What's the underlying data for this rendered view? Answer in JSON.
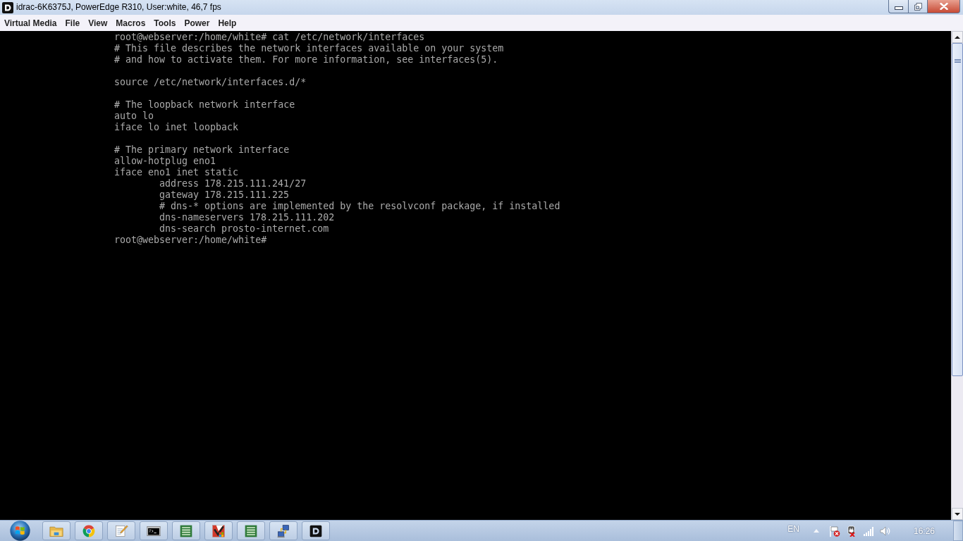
{
  "window": {
    "title": "idrac-6K6375J, PowerEdge R310, User:white, 46,7 fps"
  },
  "menu_bar": [
    "Virtual Media",
    "File",
    "View",
    "Macros",
    "Tools",
    "Power",
    "Help"
  ],
  "terminal": {
    "paragraphs": [
      [
        {
          "text": "root@webserver:/home/white# cat /etc/network/interfaces"
        },
        {
          "text": "# This file describes the network interfaces available on your system"
        },
        {
          "text": "# and how to activate them. For more information, see interfaces(5)."
        }
      ],
      [
        {
          "text": "source /etc/network/interfaces.d/*"
        }
      ],
      [
        {
          "text": "# The loopback network interface"
        },
        {
          "text": "auto lo"
        },
        {
          "text": "iface lo inet loopback"
        }
      ],
      [
        {
          "text": "# The primary network interface"
        },
        {
          "text": "allow-hotplug eno1"
        },
        {
          "text": "iface eno1 inet static",
          "children": [
            {
              "text": "address 178.215.111.241/27"
            },
            {
              "text": "gateway 178.215.111.225"
            },
            {
              "text": "# dns-* options are implemented by the resolvconf package, if installed"
            },
            {
              "text": "dns-nameservers 178.215.111.202"
            },
            {
              "text": "dns-search prosto-internet.com"
            }
          ]
        },
        {
          "text": "root@webserver:/home/white#"
        }
      ]
    ]
  },
  "taskbar": {
    "language": "EN",
    "clock": "16:26"
  }
}
